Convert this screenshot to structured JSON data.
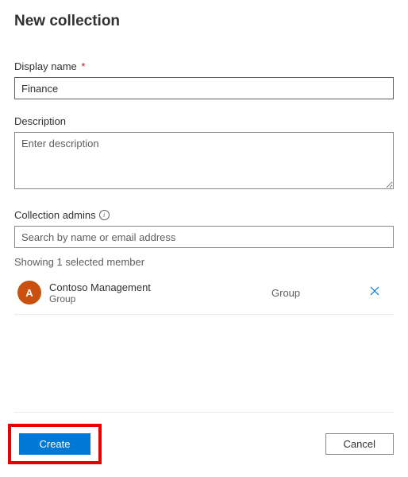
{
  "header": {
    "title": "New collection"
  },
  "form": {
    "display_name": {
      "label": "Display name",
      "required_mark": "*",
      "value": "Finance"
    },
    "description": {
      "label": "Description",
      "placeholder": "Enter description",
      "value": ""
    },
    "collection_admins": {
      "label": "Collection admins",
      "search_placeholder": "Search by name or email address",
      "selected_count_text": "Showing 1 selected member",
      "members": [
        {
          "avatar_initial": "A",
          "name": "Contoso Management",
          "sub": "Group",
          "type": "Group"
        }
      ]
    }
  },
  "footer": {
    "create_label": "Create",
    "cancel_label": "Cancel"
  }
}
